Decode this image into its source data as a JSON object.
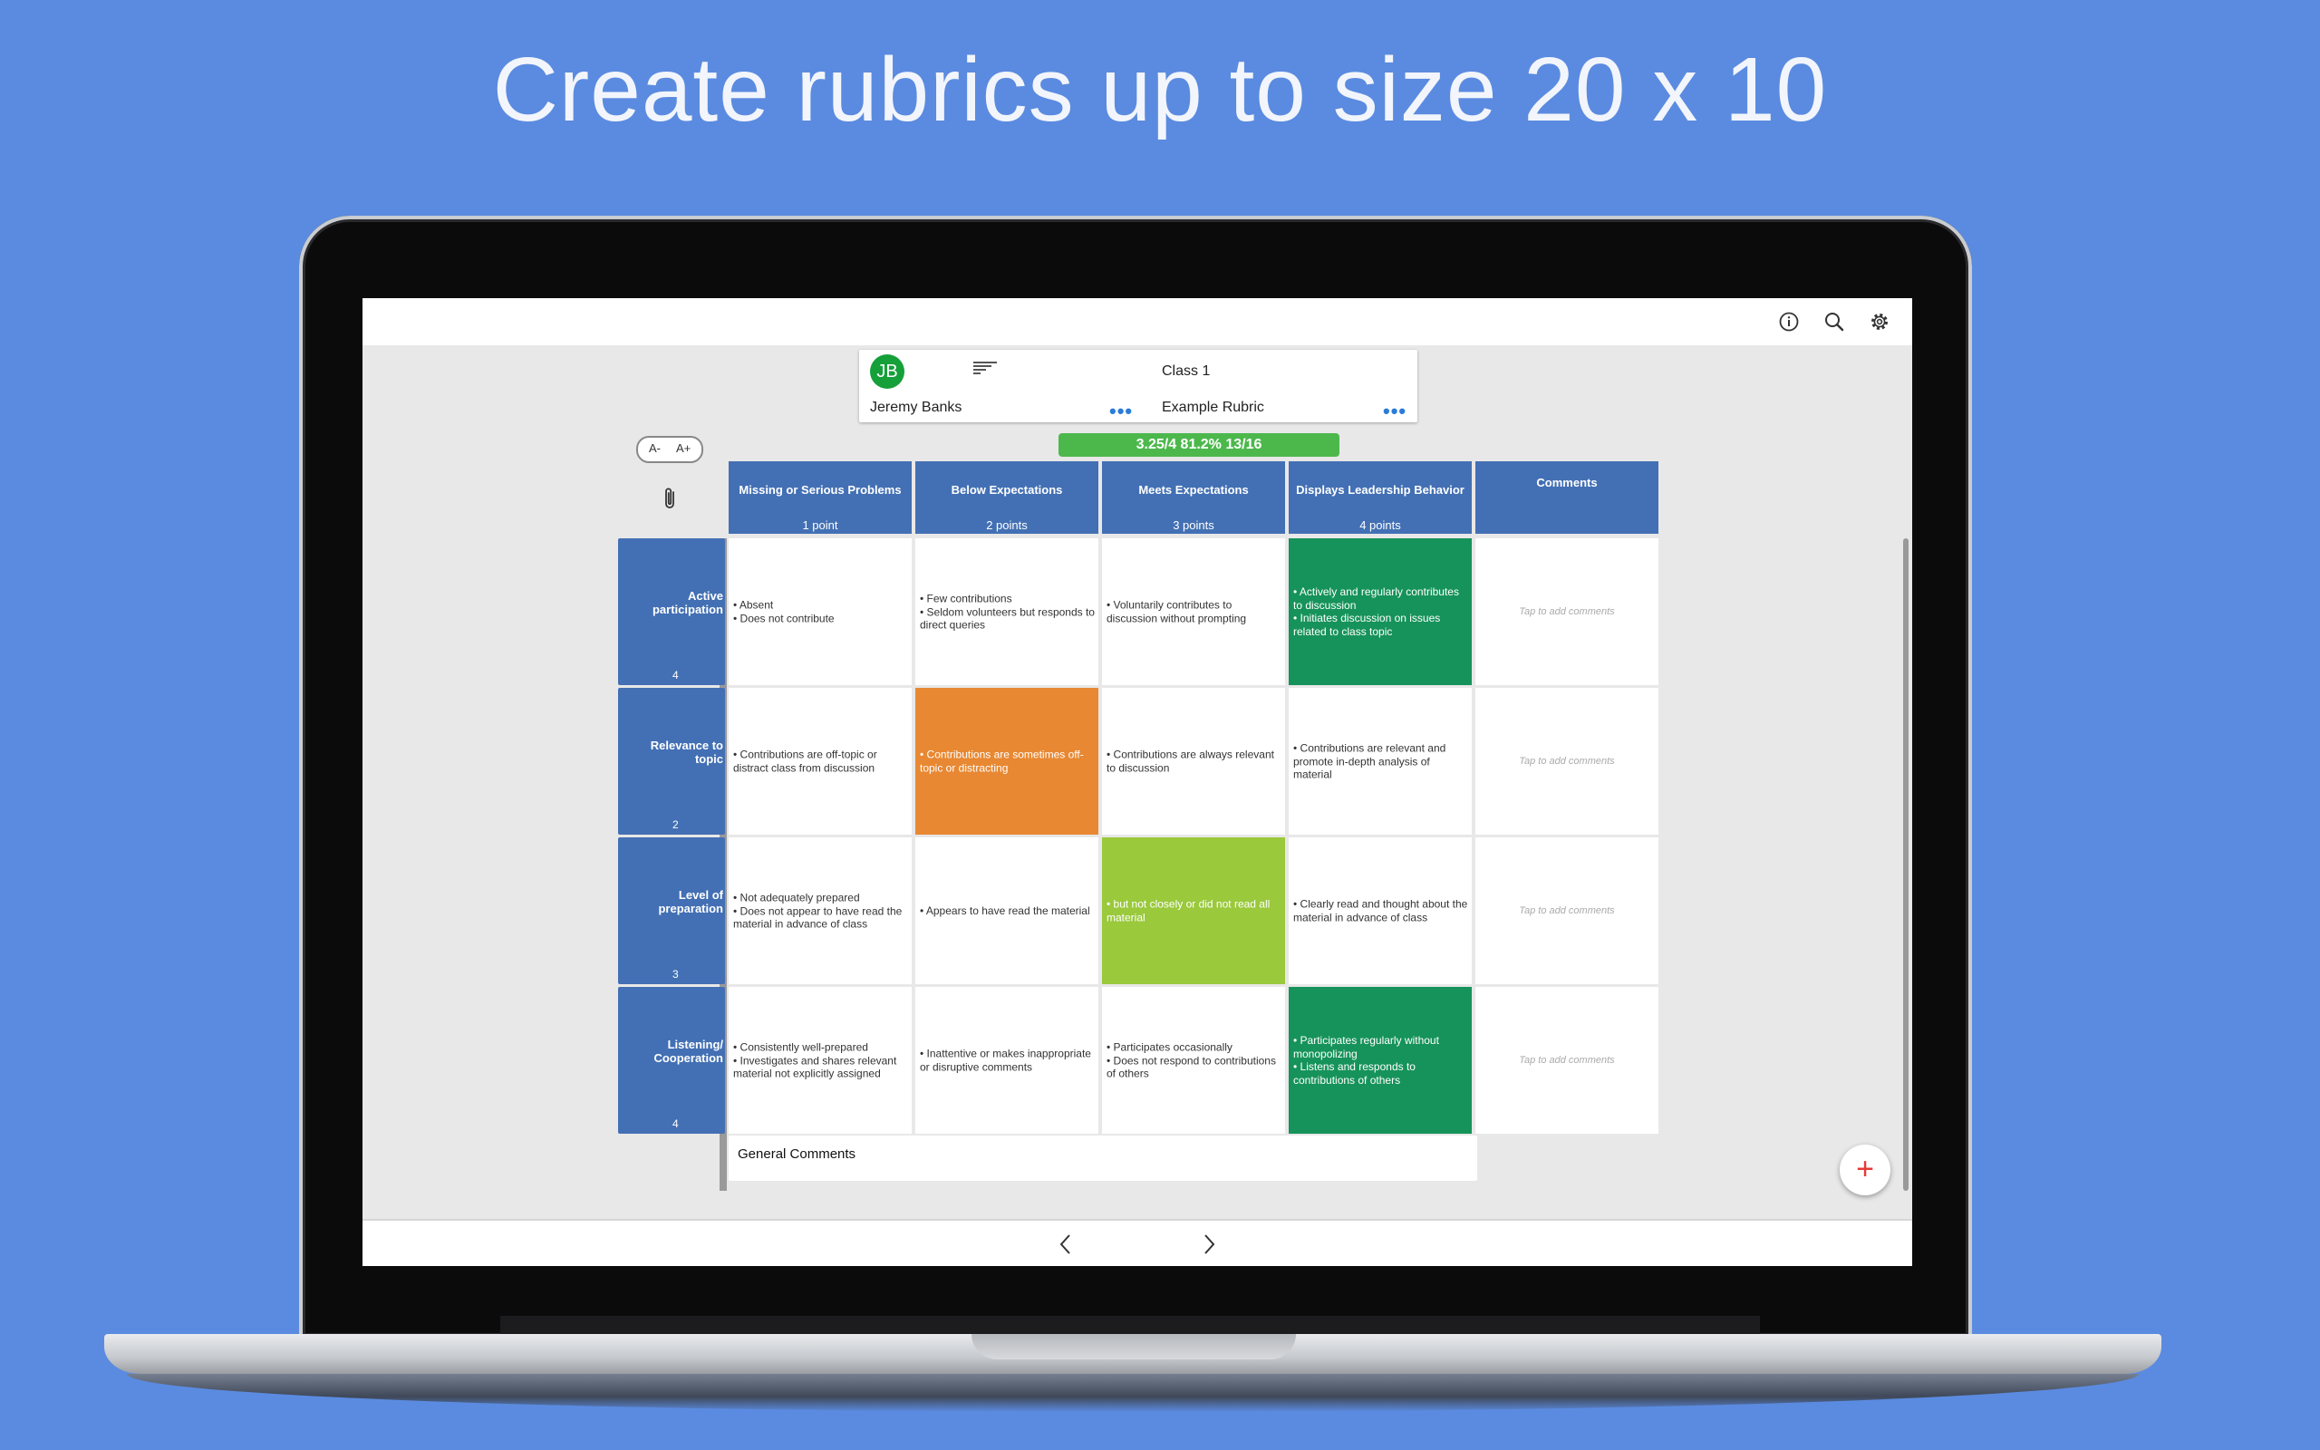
{
  "headline": "Create rubrics up to size 20 x 10",
  "toolbar": {
    "icons": [
      "info-icon",
      "search-icon",
      "gear-icon"
    ]
  },
  "student": {
    "initials": "JB",
    "name": "Jeremy Banks",
    "class_name": "Class 1",
    "rubric_name": "Example Rubric",
    "more_label": "•••"
  },
  "font_controls": {
    "decrease": "A-",
    "increase": "A+"
  },
  "score_summary": "3.25/4  81.2%  13/16",
  "columns": [
    {
      "title": "Missing or Serious Problems",
      "points": "1 point"
    },
    {
      "title": "Below Expectations",
      "points": "2 points"
    },
    {
      "title": "Meets Expectations",
      "points": "3 points"
    },
    {
      "title": "Displays Leadership Behavior",
      "points": "4 points"
    },
    {
      "title": "Comments",
      "points": ""
    }
  ],
  "rows": [
    {
      "name": "Active participation",
      "score": "4",
      "cells": [
        "• Absent\n• Does not contribute",
        "• Few contributions\n• Seldom volunteers but responds to direct queries",
        "• Voluntarily contributes to discussion without prompting",
        "• Actively and regularly contributes to discussion\n• Initiates discussion on issues related to class topic"
      ],
      "selected": 3,
      "comment": "Tap to add comments"
    },
    {
      "name": "Relevance to topic",
      "score": "2",
      "cells": [
        "• Contributions are off-topic or distract class from discussion",
        "• Contributions are sometimes off-topic or distracting",
        "• Contributions are always relevant to discussion",
        "• Contributions are relevant and promote in-depth analysis of material"
      ],
      "selected": 1,
      "comment": "Tap to add comments"
    },
    {
      "name": "Level of preparation",
      "score": "3",
      "cells": [
        "• Not adequately prepared\n• Does not appear to have read the material in advance of class",
        "• Appears to have read the material",
        "•  but not closely or did not read all material",
        "• Clearly read and thought about the material in advance of class"
      ],
      "selected": 2,
      "comment": "Tap to add comments"
    },
    {
      "name": "Listening/ Cooperation",
      "score": "4",
      "cells": [
        "• Consistently well-prepared\n• Investigates and shares relevant material not explicitly assigned",
        "• Inattentive or makes inappropriate or disruptive comments",
        "• Participates occasionally\n• Does not respond to contributions of others",
        "• Participates regularly without monopolizing\n• Listens and responds to contributions of others"
      ],
      "selected": 3,
      "comment": "Tap to add comments"
    }
  ],
  "general_comments_label": "General Comments",
  "fab_label": "+",
  "nav": {
    "prev": "‹",
    "next": "›"
  },
  "colors": {
    "background": "#5b8be0",
    "header_blue": "#4370b4",
    "selected_green": "#16935a",
    "selected_orange": "#e88832",
    "selected_lime": "#9ac93c",
    "score_bar": "#4cb84c"
  }
}
